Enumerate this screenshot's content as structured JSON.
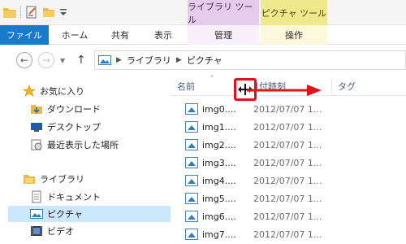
{
  "title_bar": {
    "context_tabs": [
      {
        "label": "ライブラリ ツール"
      },
      {
        "label": "ピクチャ ツール"
      }
    ]
  },
  "ribbon": {
    "tabs": [
      {
        "label": "ファイル",
        "active": true
      },
      {
        "label": "ホーム"
      },
      {
        "label": "共有"
      },
      {
        "label": "表示"
      },
      {
        "label": "管理"
      },
      {
        "label": "操作"
      }
    ]
  },
  "address_bar": {
    "breadcrumbs": [
      "ライブラリ",
      "ピクチャ"
    ]
  },
  "nav_pane": {
    "items": [
      {
        "label": "お気に入り",
        "icon": "star-icon"
      },
      {
        "label": "ダウンロード",
        "icon": "downloads-folder-icon"
      },
      {
        "label": "デスクトップ",
        "icon": "desktop-icon"
      },
      {
        "label": "最近表示した場所",
        "icon": "recent-places-icon"
      },
      {
        "label": "ライブラリ",
        "icon": "library-icon"
      },
      {
        "label": "ドキュメント",
        "icon": "documents-icon"
      },
      {
        "label": "ピクチャ",
        "icon": "pictures-icon",
        "selected": true
      },
      {
        "label": "ビデオ",
        "icon": "videos-icon"
      }
    ]
  },
  "file_list": {
    "columns": {
      "name": "名前",
      "date": "日付時刻",
      "tag": "タグ"
    },
    "files": [
      {
        "name": "img0....",
        "date": "2012/07/07 1..."
      },
      {
        "name": "img1....",
        "date": "2012/07/07 1..."
      },
      {
        "name": "img2....",
        "date": "2012/07/07 1..."
      },
      {
        "name": "img3....",
        "date": "2012/07/07 1..."
      },
      {
        "name": "img4....",
        "date": "2012/07/07 1..."
      },
      {
        "name": "img5....",
        "date": "2012/07/07 1..."
      },
      {
        "name": "img6....",
        "date": "2012/07/07 1..."
      },
      {
        "name": "img7....",
        "date": "2012/07/07 1..."
      }
    ]
  },
  "colors": {
    "file_tab": "#1979ca",
    "library_tools": "#e6ccec",
    "picture_tools": "#efe98d",
    "selection": "#cce8ff",
    "annotation": "#e2111c"
  }
}
